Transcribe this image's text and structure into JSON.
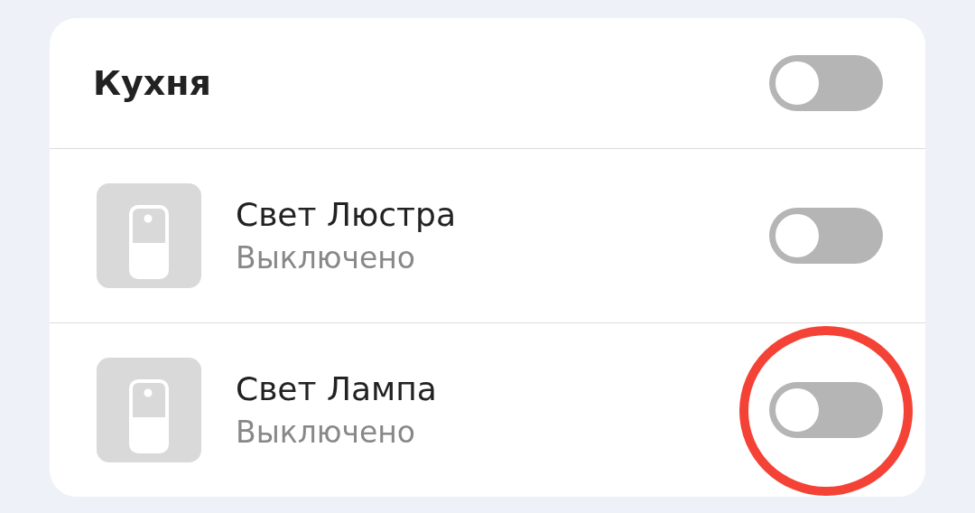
{
  "room": {
    "title": "Кухня",
    "on": false
  },
  "devices": [
    {
      "name": "Свет Люстра",
      "status": "Выключено",
      "on": false,
      "circled": false
    },
    {
      "name": "Свет Лампа",
      "status": "Выключено",
      "on": false,
      "circled": true
    }
  ]
}
